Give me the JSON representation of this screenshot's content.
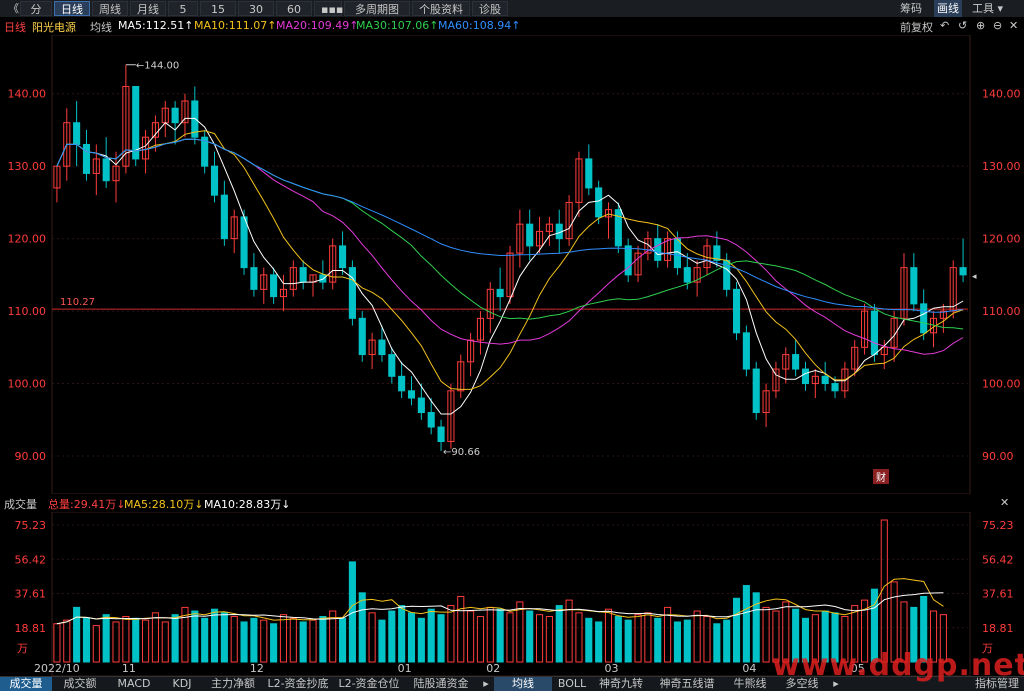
{
  "topbar": {
    "back_glyph": "《",
    "buttons": [
      "分时",
      "日线",
      "周线",
      "月线",
      "5分",
      "15分",
      "30分",
      "60分",
      "▪▪▪",
      "多周期图 ▾",
      "个股资料",
      "诊股"
    ],
    "active": "日线",
    "right": [
      "筹码",
      "画线",
      "工具 ▾"
    ]
  },
  "info": {
    "period": "日线",
    "stock": "阳光电源",
    "ma_label": "均线",
    "ma5": "MA5:112.51↑",
    "ma10": "MA10:111.07↑",
    "ma20": "MA20:109.49↑",
    "ma30": "MA30:107.06↑",
    "ma60": "MA60:108.94↑",
    "adjust": "前复权",
    "icons": [
      "undo-icon",
      "refresh-icon",
      "zoom-in-icon",
      "zoom-out-icon",
      "close-icon"
    ]
  },
  "volume_info": {
    "title": "成交量",
    "total": "总量:29.41万↓",
    "ma5": "MA5:28.10万↓",
    "ma10": "MA10:28.83万↓"
  },
  "bottom_tabs": [
    "成交量",
    "成交额",
    "MACD",
    "KDJ",
    "主力净额",
    "L2-资金抄底",
    "L2-资金仓位",
    "陆股通资金",
    "▸",
    "均线",
    "BOLL",
    "神奇九转",
    "神奇五线谱",
    "牛熊线",
    "多空线",
    "▸",
    "指标管理"
  ],
  "watermark": "www.ddgp.net",
  "chart_data": {
    "type": "candlestick",
    "colors": {
      "up": "#ff3c3c",
      "down": "#00c2c7",
      "ma5": "#ffffff",
      "ma10": "#f2c21b",
      "ma20": "#e43ad9",
      "ma30": "#2fcf4f",
      "ma60": "#2f8fff",
      "hline": "#d12a2a"
    },
    "price_axis": {
      "ticks": [
        140,
        130,
        120,
        110,
        100,
        90
      ],
      "labels": [
        "140.00",
        "130.00",
        "120.00",
        "110.00",
        "100.00",
        "90.00"
      ],
      "ylim": [
        86,
        147
      ]
    },
    "x_labels": [
      "2022/10",
      "11",
      "12",
      "01",
      "02",
      "03",
      "04",
      "05"
    ],
    "annotations": {
      "high": "144.00",
      "low": "90.66",
      "hline": "110.27",
      "hline_value": 110.27,
      "fin_badge": "财"
    },
    "volume_axis": {
      "ticks": [
        75.23,
        56.42,
        37.61,
        18.81
      ],
      "labels": [
        "75.23",
        "56.42",
        "37.61",
        "18.81"
      ],
      "unit": "万",
      "ymax": 78
    },
    "candles": [
      [
        127,
        130,
        125,
        130
      ],
      [
        130,
        138,
        128,
        136
      ],
      [
        136,
        139,
        130,
        133
      ],
      [
        133,
        135,
        128,
        129
      ],
      [
        129,
        133,
        126,
        131
      ],
      [
        131,
        134,
        127,
        128
      ],
      [
        128,
        132,
        125,
        130
      ],
      [
        130,
        144,
        129,
        141
      ],
      [
        141,
        141,
        130,
        131
      ],
      [
        131,
        135,
        129,
        134
      ],
      [
        134,
        137,
        132,
        136
      ],
      [
        136,
        139,
        134,
        138
      ],
      [
        138,
        139,
        133,
        136
      ],
      [
        136,
        140,
        134,
        139
      ],
      [
        139,
        141,
        133,
        134
      ],
      [
        134,
        135,
        129,
        130
      ],
      [
        130,
        132,
        125,
        126
      ],
      [
        126,
        128,
        119,
        120
      ],
      [
        120,
        124,
        118,
        123
      ],
      [
        123,
        124,
        115,
        116
      ],
      [
        116,
        118,
        112,
        113
      ],
      [
        113,
        116,
        111,
        115
      ],
      [
        115,
        116,
        111,
        112
      ],
      [
        112,
        115,
        110,
        113
      ],
      [
        113,
        117,
        112,
        116
      ],
      [
        116,
        117,
        113,
        114
      ],
      [
        114,
        115,
        112,
        115
      ],
      [
        115,
        117,
        113,
        114
      ],
      [
        114,
        120,
        113,
        119
      ],
      [
        119,
        121,
        115,
        116
      ],
      [
        116,
        117,
        108,
        109
      ],
      [
        109,
        110,
        103,
        104
      ],
      [
        104,
        107,
        102,
        106
      ],
      [
        106,
        108,
        103,
        104
      ],
      [
        104,
        105,
        100,
        101
      ],
      [
        101,
        103,
        98,
        99
      ],
      [
        99,
        101,
        97,
        98
      ],
      [
        98,
        100,
        95,
        96
      ],
      [
        96,
        98,
        93,
        94
      ],
      [
        94,
        95,
        90.7,
        92
      ],
      [
        92,
        100,
        91,
        99
      ],
      [
        99,
        104,
        98,
        103
      ],
      [
        103,
        107,
        101,
        106
      ],
      [
        106,
        110,
        104,
        109
      ],
      [
        109,
        114,
        107,
        113
      ],
      [
        113,
        116,
        110,
        112
      ],
      [
        112,
        119,
        111,
        118
      ],
      [
        118,
        124,
        116,
        122
      ],
      [
        122,
        124,
        117,
        119
      ],
      [
        119,
        123,
        118,
        121
      ],
      [
        121,
        123,
        119,
        122
      ],
      [
        122,
        124,
        118,
        120
      ],
      [
        120,
        126,
        119,
        125
      ],
      [
        125,
        132,
        123,
        131
      ],
      [
        131,
        133,
        126,
        127
      ],
      [
        127,
        128,
        122,
        123
      ],
      [
        123,
        125,
        120,
        124
      ],
      [
        124,
        125,
        118,
        119
      ],
      [
        119,
        120,
        114,
        115
      ],
      [
        115,
        119,
        114,
        118
      ],
      [
        118,
        121,
        117,
        120
      ],
      [
        120,
        122,
        116,
        117
      ],
      [
        117,
        121,
        116,
        120
      ],
      [
        120,
        121,
        115,
        116
      ],
      [
        116,
        118,
        113,
        114
      ],
      [
        114,
        117,
        112,
        116
      ],
      [
        116,
        120,
        115,
        119
      ],
      [
        119,
        121,
        116,
        117
      ],
      [
        117,
        118,
        112,
        113
      ],
      [
        113,
        114,
        106,
        107
      ],
      [
        107,
        108,
        101,
        102
      ],
      [
        102,
        103,
        95,
        96
      ],
      [
        96,
        100,
        94,
        99
      ],
      [
        99,
        103,
        98,
        102
      ],
      [
        102,
        105,
        100,
        104
      ],
      [
        104,
        106,
        101,
        102
      ],
      [
        102,
        103,
        99,
        100
      ],
      [
        100,
        102,
        98,
        101
      ],
      [
        101,
        103,
        99,
        100
      ],
      [
        100,
        101,
        98,
        99
      ],
      [
        99,
        103,
        98,
        102
      ],
      [
        102,
        106,
        101,
        105
      ],
      [
        105,
        111,
        104,
        110
      ],
      [
        110,
        111,
        103,
        104
      ],
      [
        104,
        106,
        102,
        105
      ],
      [
        105,
        110,
        103,
        109
      ],
      [
        109,
        118,
        108,
        116
      ],
      [
        116,
        118,
        110,
        111
      ],
      [
        111,
        113,
        106,
        107
      ],
      [
        107,
        110,
        105,
        109
      ],
      [
        109,
        111,
        107,
        110
      ],
      [
        110,
        117,
        109,
        116
      ],
      [
        116,
        120,
        114,
        115
      ]
    ],
    "volumes": [
      21,
      23,
      30,
      24,
      20,
      26,
      22,
      25,
      24,
      23,
      27,
      22,
      26,
      30,
      28,
      24,
      29,
      27,
      25,
      22,
      24,
      23,
      21,
      26,
      24,
      22,
      23,
      25,
      28,
      24,
      55,
      38,
      27,
      23,
      28,
      31,
      27,
      24,
      29,
      26,
      31,
      36,
      28,
      25,
      30,
      29,
      27,
      33,
      28,
      26,
      25,
      31,
      34,
      27,
      24,
      22,
      29,
      25,
      23,
      26,
      27,
      24,
      30,
      22,
      23,
      28,
      25,
      21,
      23,
      35,
      42,
      38,
      30,
      28,
      33,
      29,
      24,
      26,
      28,
      27,
      25,
      31,
      34,
      40,
      78,
      44,
      33,
      30,
      36,
      28,
      26
    ]
  }
}
